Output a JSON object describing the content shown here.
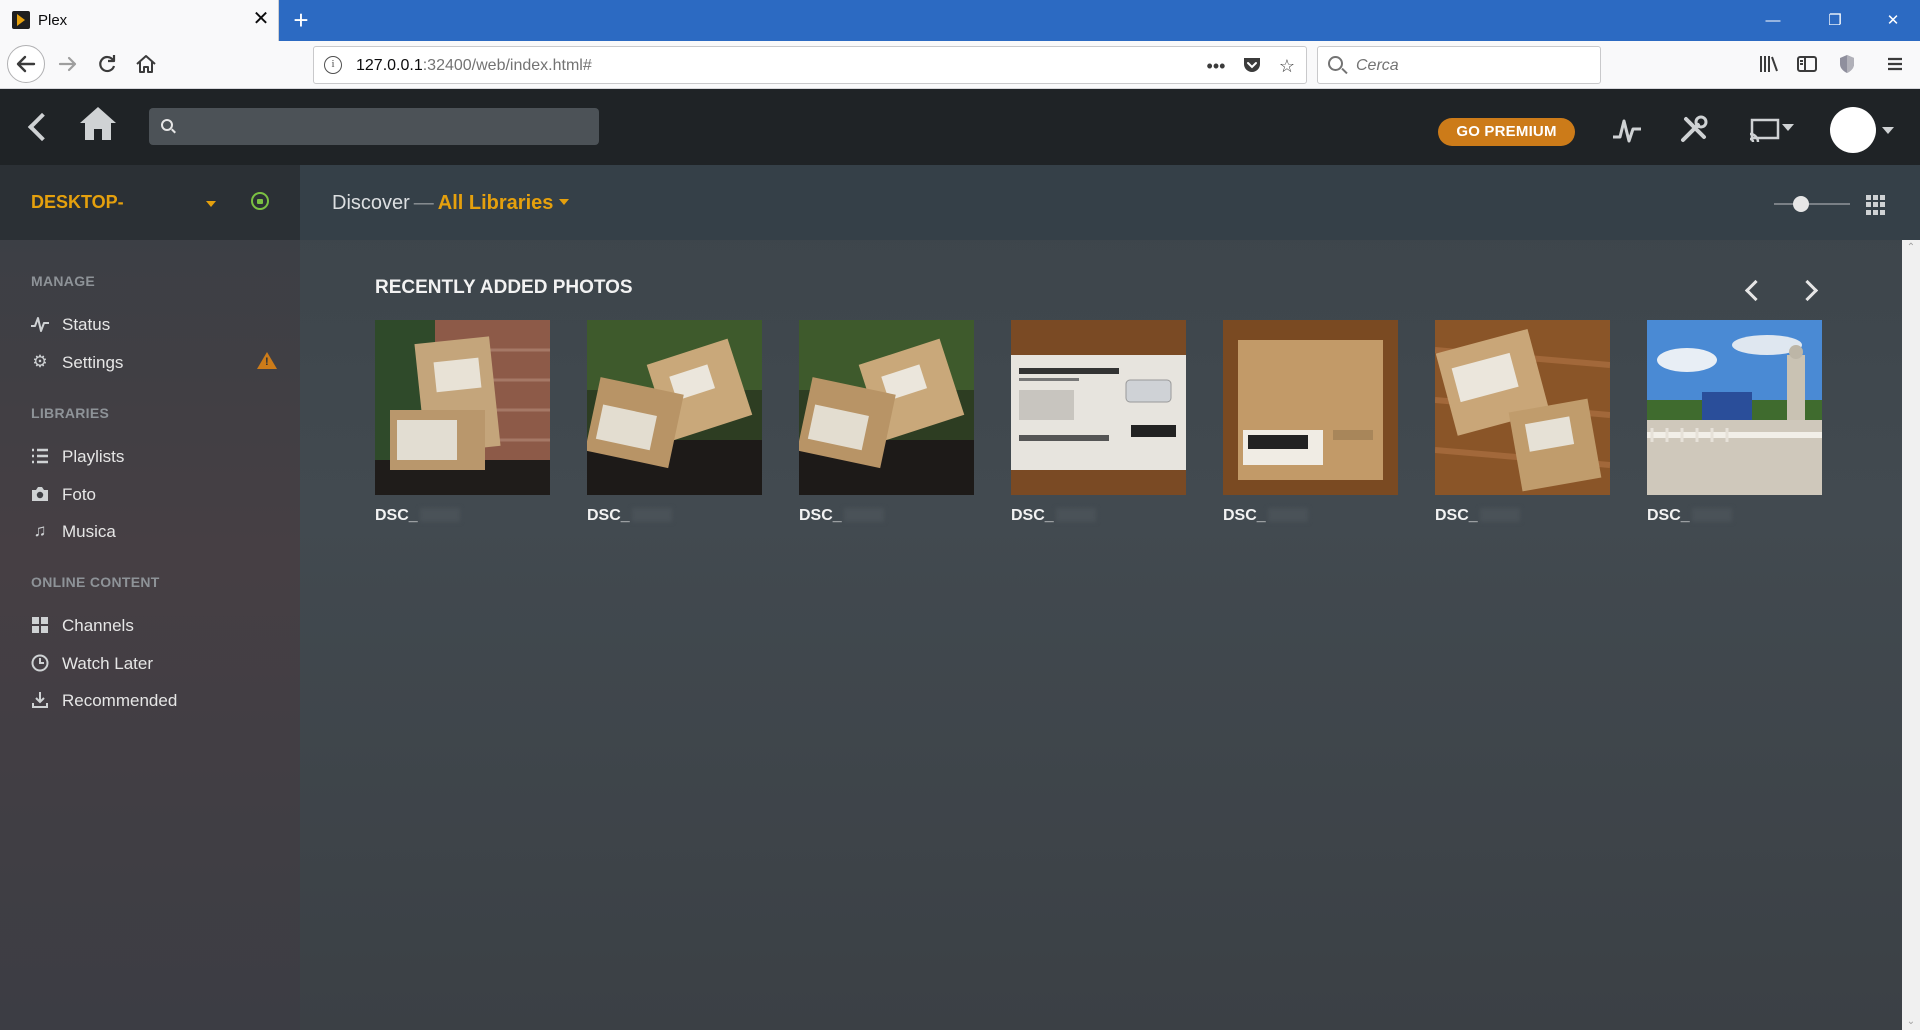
{
  "browser": {
    "tab_title": "Plex",
    "tab_close": "✕",
    "new_tab": "+",
    "url_host": "127.0.0.1",
    "url_rest": ":32400/web/index.html#",
    "search_placeholder": "Cerca",
    "window_controls": {
      "minimize": "—",
      "restore": "❐",
      "close": "✕"
    },
    "icons": {
      "back": "back-arrow-icon",
      "forward": "forward-arrow-icon",
      "reload": "reload-icon",
      "home": "home-icon",
      "page_actions": "more-dots-icon",
      "pocket": "pocket-icon",
      "bookmark": "star-icon",
      "library": "library-icon",
      "sidebar": "sidebar-icon",
      "tracking": "shield-icon",
      "menu": "hamburger-menu-icon"
    }
  },
  "header": {
    "premium_label": "GO PREMIUM",
    "icons": [
      "activity-icon",
      "tools-icon",
      "cast-icon",
      "user-avatar"
    ]
  },
  "sidebar": {
    "server_name": "DESKTOP-",
    "sections": [
      {
        "label": "MANAGE"
      },
      {
        "label": "LIBRARIES"
      },
      {
        "label": "ONLINE CONTENT"
      }
    ],
    "items": [
      {
        "label": "Status",
        "icon": "activity-icon"
      },
      {
        "label": "Settings",
        "icon": "gear-icon",
        "warning": "!"
      },
      {
        "label": "Playlists",
        "icon": "list-icon"
      },
      {
        "label": "Foto",
        "icon": "camera-icon"
      },
      {
        "label": "Musica",
        "icon": "music-note-icon"
      },
      {
        "label": "Channels",
        "icon": "grid-icon"
      },
      {
        "label": "Watch Later",
        "icon": "clock-icon"
      },
      {
        "label": "Recommended",
        "icon": "download-icon"
      }
    ]
  },
  "main": {
    "discover_label": "Discover",
    "dash": "—",
    "libraries_label": "All Libraries",
    "section_title": "RECENTLY ADDED PHOTOS",
    "photos": [
      {
        "label": "DSC_"
      },
      {
        "label": "DSC_"
      },
      {
        "label": "DSC_"
      },
      {
        "label": "DSC_"
      },
      {
        "label": "DSC_"
      },
      {
        "label": "DSC_"
      },
      {
        "label": "DSC_"
      }
    ]
  },
  "colors": {
    "accent": "#e5a00d",
    "premium": "#cc7b19",
    "header_bg": "#1f2326",
    "browser_titlebar": "#2c6ac2"
  }
}
